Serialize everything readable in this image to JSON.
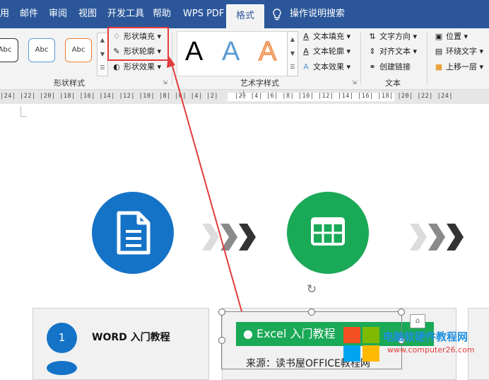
{
  "menu": {
    "tabs": [
      {
        "id": "partial-use",
        "label": "用"
      },
      {
        "id": "mailings",
        "label": "邮件"
      },
      {
        "id": "review",
        "label": "审阅"
      },
      {
        "id": "view",
        "label": "视图"
      },
      {
        "id": "developer",
        "label": "开发工具"
      },
      {
        "id": "help",
        "label": "帮助"
      },
      {
        "id": "wps-pdf",
        "label": "WPS PDF"
      },
      {
        "id": "format",
        "label": "格式"
      }
    ],
    "search_label": "操作说明搜索"
  },
  "ribbon": {
    "shape_style_samples": [
      "Abc",
      "Abc",
      "Abc"
    ],
    "shape_fill": "形状填充",
    "shape_outline": "形状轮廓",
    "shape_effects": "形状效果",
    "shape_styles_group": "形状样式",
    "wordart_letters": [
      "A",
      "A",
      "A"
    ],
    "text_fill": "文本填充",
    "text_outline": "文本轮廓",
    "text_effects": "文本效果",
    "wordart_group": "艺术字样式",
    "text_direction": "文字方向",
    "align_text": "对齐文本",
    "create_link": "创建链接",
    "text_group": "文本",
    "position": "位置",
    "wrap_text": "环绕文字",
    "bring_forward": "上移一层"
  },
  "ruler": {
    "left_ticks": "|24| |22| |20| |18| |16| |14| |12| |10| |8| |6| |4| |2|",
    "right_ticks": "|2| |4| |6| |8| |10| |12| |14| |16| |18| |20| |22| |24|"
  },
  "document": {
    "card1": {
      "number": "1",
      "title": "WORD 入门教程"
    },
    "card2": {
      "header": "● Excel 入门教程",
      "subtitle": "来源：读书屋OFFICE教程网"
    }
  },
  "watermark": {
    "site_name": "电脑软硬件教程网",
    "url": "www.computer26.com"
  },
  "colors": {
    "accent": "#2b579a",
    "highlight_red": "#e23c3c",
    "word_blue": "#1573c7",
    "excel_green": "#1aa956"
  }
}
